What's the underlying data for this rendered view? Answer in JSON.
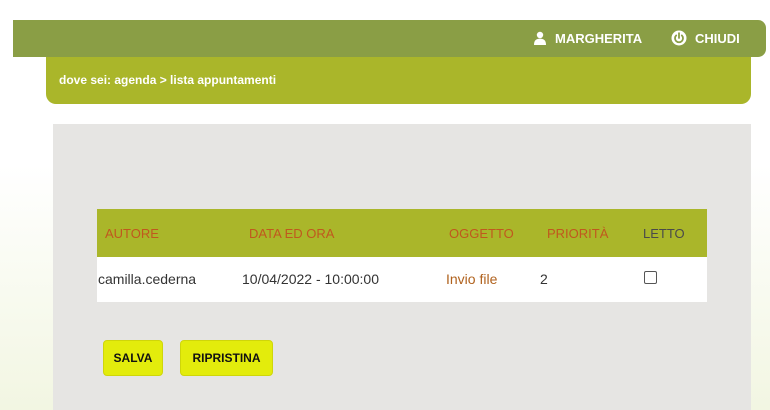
{
  "header": {
    "user_name": "MARGHERITA",
    "user_icon": "user-icon",
    "logout_label": "CHIUDI",
    "logout_icon": "power-icon"
  },
  "breadcrumb": {
    "text": "dove sei: agenda > lista appuntamenti"
  },
  "table": {
    "headers": [
      "AUTORE",
      "DATA ED ORA",
      "OGGETTO",
      "PRIORITÀ",
      "LETTO"
    ],
    "rows": [
      {
        "autore": "camilla.cederna",
        "data_ora": "10/04/2022 - 10:00:00",
        "oggetto": "Invio file",
        "priorita": "2",
        "letto": false
      }
    ]
  },
  "actions": {
    "save_label": "SALVA",
    "reset_label": "RIPRISTINA"
  },
  "colors": {
    "topbar": "#8a9e45",
    "breadcrumb_bar": "#aab62a",
    "table_header": "#aab62a",
    "header_text": "#c0581e",
    "button": "#e3ec0c"
  }
}
